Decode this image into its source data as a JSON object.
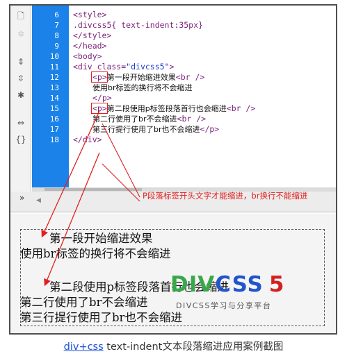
{
  "toolbar": {
    "icons": [
      "page-icon",
      "star-icon",
      "code-expand-icon",
      "code-collapse-icon",
      "select-parent-icon",
      "indent-icon",
      "format-icon",
      "collapse-icon"
    ]
  },
  "editor": {
    "lines": [
      {
        "num": "6",
        "text": "<style>"
      },
      {
        "num": "7",
        "text": ".divcss5{ text-indent:35px}"
      },
      {
        "num": "8",
        "text": "</style>"
      },
      {
        "num": "9",
        "text": "</head>"
      },
      {
        "num": "10",
        "text": "<body>"
      },
      {
        "num": "11",
        "text": "<div class=\"divcss5\">"
      },
      {
        "num": "12",
        "tag": "<p>",
        "cj": "第一段开始缩进效果",
        "tail": "<br />"
      },
      {
        "num": "13",
        "cj": "使用br标签的换行将不会缩进"
      },
      {
        "num": "14",
        "text": "</p>"
      },
      {
        "num": "15",
        "tag": "<p>",
        "cj": "第二段使用p标签段落首行也会缩进",
        "tail": "<br />"
      },
      {
        "num": "16",
        "cj": "第二行使用了br不会缩进",
        "tail": "<br />"
      },
      {
        "num": "17",
        "cj": "第三行提行使用了br也不会缩进",
        "tail": "</p>"
      },
      {
        "num": "18",
        "text": "</div>"
      }
    ],
    "note": "P段落标签开头文字才能缩进，br换行不能缩进"
  },
  "preview": {
    "lines": [
      "第一段开始缩进效果",
      "使用br标签的换行将不会缩进",
      "第二段使用p标签段落首行也会缩进",
      "第二行使用了br不会缩进",
      "第三行提行使用了br也不会缩进"
    ],
    "watermark_main": "DIVCSS5",
    "watermark_sub": "DIVCSS学习与分享平台"
  },
  "caption": {
    "link": "div+css",
    "text": " text-indent文本段落缩进应用案例截图"
  },
  "colors": {
    "gutter": "#1a82e8",
    "annotation": "#e02020",
    "link": "#1a4fd6"
  }
}
